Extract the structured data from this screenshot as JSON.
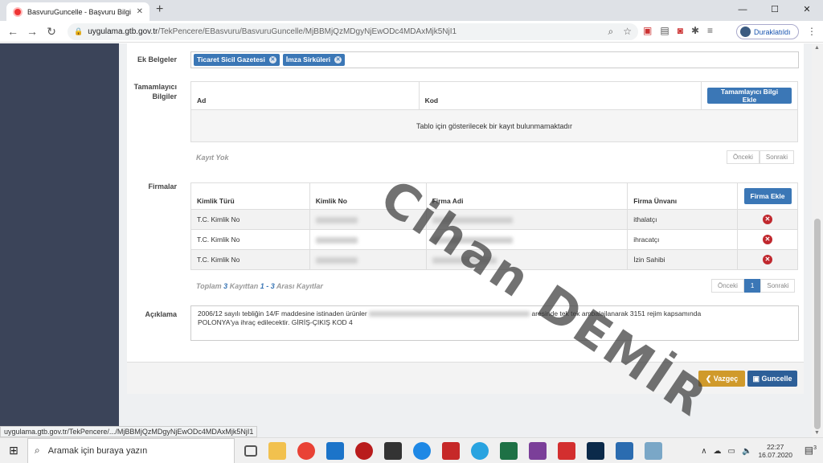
{
  "browser": {
    "tab_title": "BasvuruGuncelle - Başvuru Bilgi S",
    "new_tab": "+",
    "window_controls": [
      "—",
      "☐",
      "✕"
    ],
    "url_host": "uygulama.gtb.gov.tr",
    "url_path": "/TekPencere/EBasvuru/BasvuruGuncelle/MjBBMjQzMDgyNjEwODc4MDAxMjk5NjI1",
    "profile_label": "Duraklatıldı",
    "status_url": "uygulama.gtb.gov.tr/TekPencere/.../MjBBMjQzMDgyNjEwODc4MDAxMjk5NjI1"
  },
  "form": {
    "ek_belgeler": {
      "label": "Ek Belgeler",
      "tags": [
        "Ticaret Sicil Gazetesi",
        "İmza Sirküleri"
      ]
    },
    "tamamlayici": {
      "label_line1": "Tamamlayıcı",
      "label_line2": "Bilgiler",
      "col_ad": "Ad",
      "col_kod": "Kod",
      "add_button": "Tamamlayıcı Bilgi Ekle",
      "empty_message": "Tablo için gösterilecek bir kayıt bulunmamaktadır",
      "no_records": "Kayıt Yok",
      "prev": "Önceki",
      "next": "Sonraki"
    },
    "firmalar": {
      "label": "Firmalar",
      "col_kimlik_turu": "Kimlik Türü",
      "col_kimlik_no": "Kimlik No",
      "col_firma_adi": "Firma Adi",
      "col_firma_unvani": "Firma Ünvanı",
      "add_button": "Firma Ekle",
      "rows": [
        {
          "kimlik_turu": "T.C. Kimlik No",
          "unvan": "ithalatçı"
        },
        {
          "kimlik_turu": "T.C. Kimlik No",
          "unvan": "ihracatçı"
        },
        {
          "kimlik_turu": "T.C. Kimlik No",
          "unvan": "İzin Sahibi"
        }
      ],
      "summary_prefix": "Toplam ",
      "summary_total": "3",
      "summary_mid": " Kayıttan ",
      "summary_range": "1 - 3",
      "summary_suffix": " Arası Kayıtlar",
      "prev": "Önceki",
      "page": "1",
      "next": "Sonraki"
    },
    "aciklama": {
      "label": "Açıklama",
      "text_part1": "2006/12 sayılı tebliğin 14/F  maddesine istinaden ürünler",
      "text_part2": "aresinde tek tek ambalajlanarak  3151 rejim kapsamında",
      "text_line2": "POLONYA'ya ihraç edilecektir. GİRİŞ-ÇIKIŞ KOD 4"
    },
    "buttons": {
      "cancel": "Vazgeç",
      "save": "Guncelle"
    }
  },
  "watermark": "Cihan DEMİR",
  "taskbar": {
    "search_placeholder": "Aramak için buraya yazın",
    "time": "22:27",
    "date": "16.07.2020",
    "notif_count": "3"
  }
}
